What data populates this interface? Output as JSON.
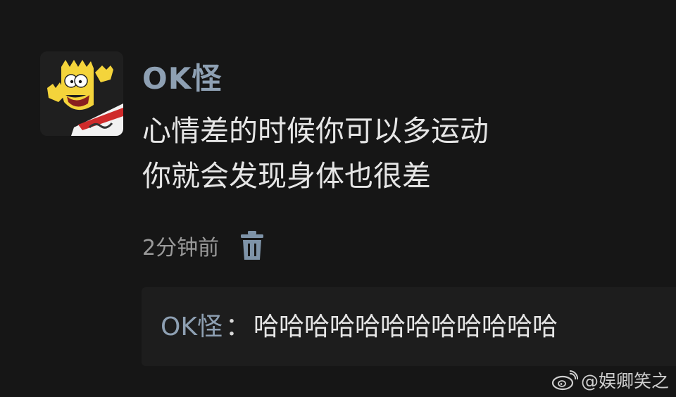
{
  "comment": {
    "username": "OK怪",
    "lines": [
      "心情差的时候你可以多运动",
      "你就会发现身体也很差"
    ],
    "timestamp": "2分钟前"
  },
  "reply": {
    "username": "OK怪",
    "separator": "：",
    "text": "哈哈哈哈哈哈哈哈哈哈哈哈"
  },
  "watermark": {
    "text": "@娱卿笑之"
  },
  "icons": {
    "delete": "trash-icon",
    "watermark_logo": "weibo-logo-icon"
  },
  "colors": {
    "background": "#161616",
    "username": "#8ea0b3",
    "text": "#e6e6e6",
    "timestamp": "#9a9a9a",
    "trash": "#7e93a8"
  }
}
